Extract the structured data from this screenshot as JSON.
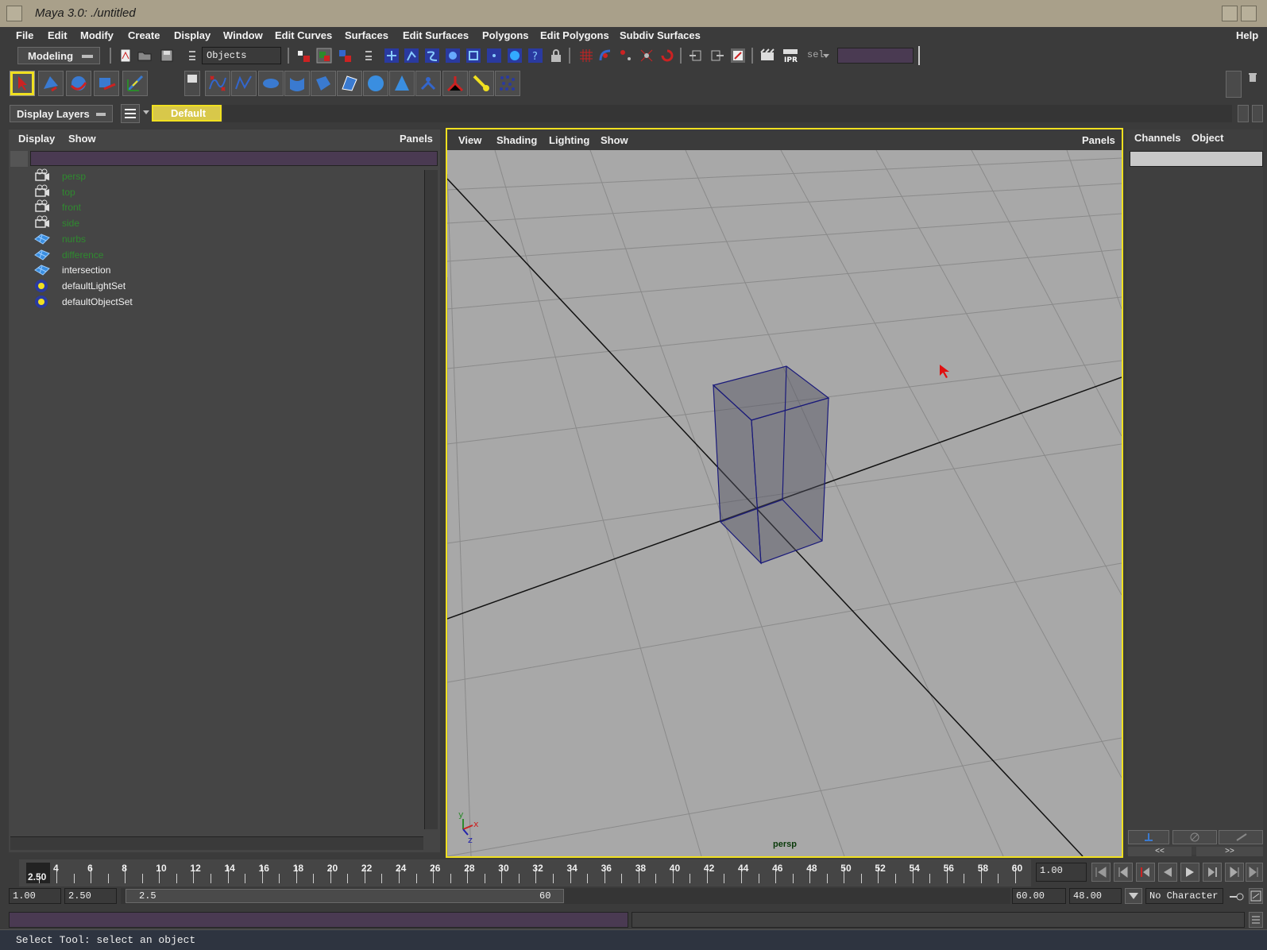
{
  "window": {
    "title": "Maya 3.0: ./untitled"
  },
  "menubar": {
    "items": [
      "File",
      "Edit",
      "Modify",
      "Create",
      "Display",
      "Window",
      "Edit Curves",
      "Surfaces",
      "Edit Surfaces",
      "Polygons",
      "Edit Polygons",
      "Subdiv Surfaces"
    ],
    "help": "Help"
  },
  "status_line": {
    "menu_set": "Modeling",
    "selection_mode": "Objects",
    "sel_label": "sel"
  },
  "layers": {
    "label": "Display Layers",
    "default_layer": "Default"
  },
  "outliner": {
    "menus": [
      "Display",
      "Show"
    ],
    "panels": "Panels",
    "items": [
      {
        "label": "persp",
        "icon": "camera-icon",
        "hidden": true
      },
      {
        "label": "top",
        "icon": "camera-icon",
        "hidden": true
      },
      {
        "label": "front",
        "icon": "camera-icon",
        "hidden": true
      },
      {
        "label": "side",
        "icon": "camera-icon",
        "hidden": true
      },
      {
        "label": "nurbs",
        "icon": "surface-icon",
        "hidden": true
      },
      {
        "label": "difference",
        "icon": "surface-icon",
        "hidden": true
      },
      {
        "label": "intersection",
        "icon": "surface-icon",
        "hidden": false
      },
      {
        "label": "defaultLightSet",
        "icon": "set-icon",
        "hidden": false
      },
      {
        "label": "defaultObjectSet",
        "icon": "set-icon",
        "hidden": false
      }
    ]
  },
  "viewport": {
    "menus": [
      "View",
      "Shading",
      "Lighting",
      "Show"
    ],
    "panels": "Panels",
    "camera": "persp",
    "axis_x": "x",
    "axis_y": "y",
    "axis_z": "z"
  },
  "channel_box": {
    "tabs": [
      "Channels",
      "Object"
    ],
    "prev": "<<",
    "next": ">>"
  },
  "timeline": {
    "ticks": [
      "4",
      "6",
      "8",
      "10",
      "12",
      "14",
      "16",
      "18",
      "20",
      "22",
      "24",
      "26",
      "28",
      "30",
      "32",
      "34",
      "36",
      "38",
      "40",
      "42",
      "44",
      "46",
      "48",
      "50",
      "52",
      "54",
      "56",
      "58",
      "60"
    ],
    "current_time_marker": "2.50",
    "current_frame": "1.00"
  },
  "range": {
    "start": "1.00",
    "playback_start": "2.50",
    "slider_start": "2.5",
    "slider_end": "60",
    "playback_end": "60.00",
    "end": "48.00",
    "character": "No Character"
  },
  "help_line": "Select Tool: select an object",
  "colors": {
    "accent": "#f0e020",
    "hidden_text": "#2f8a2f",
    "viewport_bg": "#a8a8a8"
  }
}
